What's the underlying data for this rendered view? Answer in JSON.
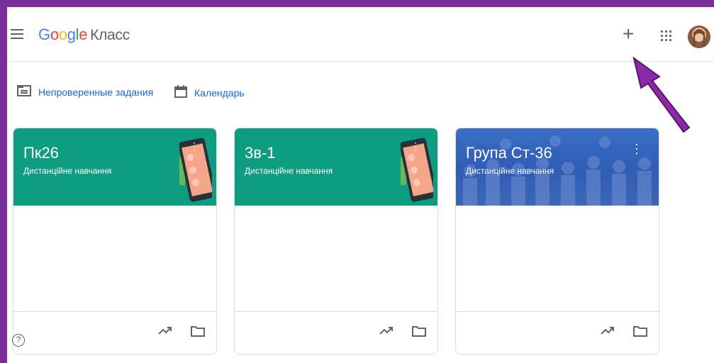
{
  "header": {
    "logo_google": [
      "G",
      "o",
      "o",
      "g",
      "l",
      "e"
    ],
    "product": "Класс"
  },
  "subnav": {
    "review_label": "Непроверенные задания",
    "calendar_label": "Календарь"
  },
  "cards": [
    {
      "title": "Пк26",
      "subtitle": "Дистанційне навчання",
      "theme": "teal-phone"
    },
    {
      "title": "3в-1",
      "subtitle": "Дистанційне навчання",
      "theme": "teal-phone"
    },
    {
      "title": "Група Ст-36",
      "subtitle": "Дистанційне навчання",
      "theme": "blue-photo"
    }
  ],
  "colors": {
    "frame": "#7b2f9e",
    "teal": "#0f9d82",
    "link": "#1967d2",
    "arrow": "#8a2aa6"
  },
  "icons": [
    "menu-icon",
    "plus-icon",
    "apps-icon",
    "assignment-icon",
    "calendar-icon",
    "kebab-icon",
    "trending-icon",
    "folder-icon",
    "help-icon"
  ]
}
